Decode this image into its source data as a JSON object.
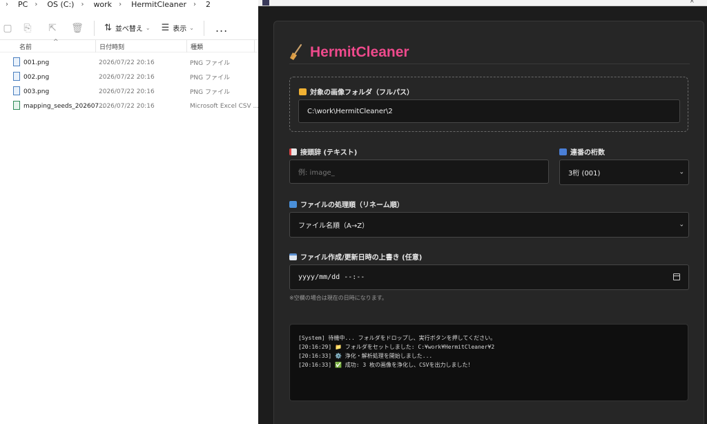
{
  "explorer": {
    "breadcrumb": [
      "PC",
      "OS (C:)",
      "work",
      "HermitCleaner",
      "2"
    ],
    "toolbar": {
      "sort_label": "並べ替え",
      "view_label": "表示",
      "more_label": "..."
    },
    "columns": {
      "name": "名前",
      "date": "日付時刻",
      "type": "種類"
    },
    "files": [
      {
        "name": "001.png",
        "date": "2026/07/22 20:16",
        "type": "PNG ファイル"
      },
      {
        "name": "002.png",
        "date": "2026/07/22 20:16",
        "type": "PNG ファイル"
      },
      {
        "name": "003.png",
        "date": "2026/07/22 20:16",
        "type": "PNG ファイル"
      },
      {
        "name": "mapping_seeds_202607...",
        "date": "2026/07/22 20:16",
        "type": "Microsoft Excel CSV ..."
      }
    ]
  },
  "app": {
    "title": "HermitCleaner",
    "accent_color": "#ee4a8c",
    "folder": {
      "label": "対象の画像フォルダ（フルパス）",
      "value": "C:\\work\\HermitCleaner\\2"
    },
    "prefix": {
      "label": "接頭辞 (テキスト)",
      "placeholder": "例: image_"
    },
    "digits": {
      "label": "連番の桁数",
      "selected": "3桁 (001)"
    },
    "order": {
      "label": "ファイルの処理順（リネーム順）",
      "selected": "ファイル名順（A→Z）"
    },
    "datetime": {
      "label": "ファイル作成/更新日時の上書き (任意)",
      "value": "yyyy/mm/dd --:--",
      "hint": "※空欄の場合は現在の日時になります。"
    },
    "log": [
      "[System] 待機中... フォルダをドロップし、実行ボタンを押してください。",
      "[20:16:29] 📁 フォルダをセットしました: C:¥work¥HermitCleaner¥2",
      "[20:16:33] ⚙️ 浄化・解析処理を開始しました...",
      "[20:16:33] ✅ 成功: 3 枚の画像を浄化し、CSVを出力しました！"
    ]
  }
}
